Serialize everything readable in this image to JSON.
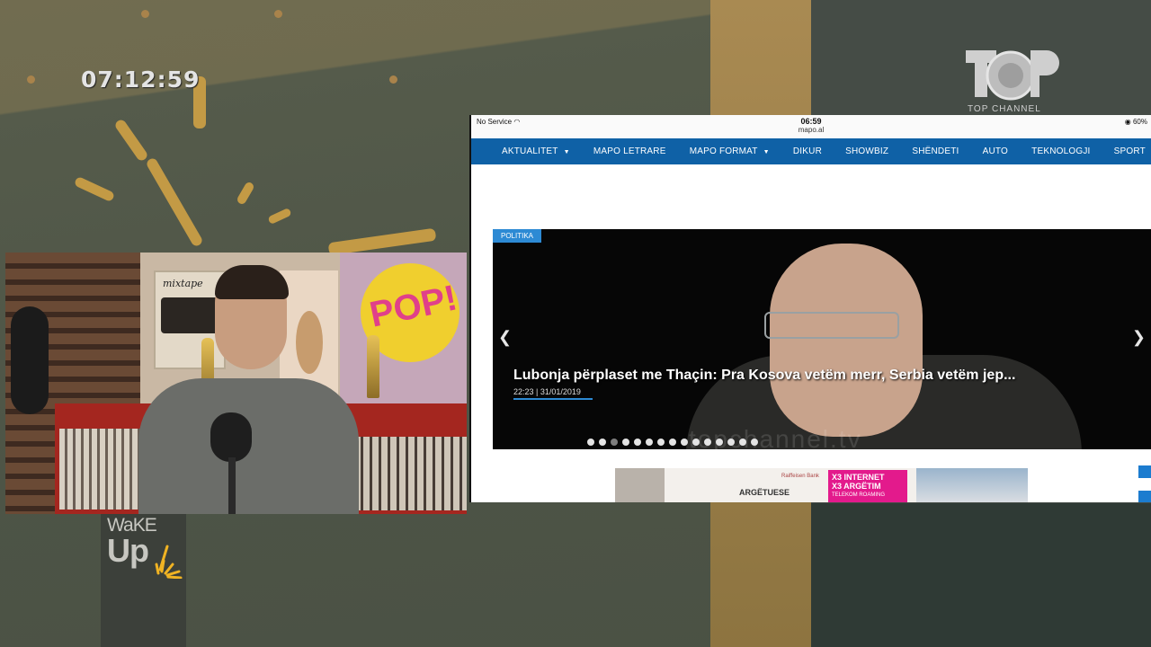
{
  "overlay": {
    "clock": "07:12:59",
    "channel_logo": "TOP CHANNEL",
    "show_logo": {
      "line1": "WaKE",
      "line2": "Up"
    }
  },
  "tablet": {
    "status": {
      "carrier": "No Service",
      "time": "06:59",
      "url": "mapo.al",
      "battery": "60%"
    },
    "nav": [
      {
        "label": "AKTUALITET",
        "has_dropdown": true
      },
      {
        "label": "MAPO LETRARE",
        "has_dropdown": false
      },
      {
        "label": "MAPO FORMAT",
        "has_dropdown": true
      },
      {
        "label": "DIKUR",
        "has_dropdown": false
      },
      {
        "label": "SHOWBIZ",
        "has_dropdown": false
      },
      {
        "label": "SHËNDETI",
        "has_dropdown": false
      },
      {
        "label": "AUTO",
        "has_dropdown": false
      },
      {
        "label": "TEKNOLOGJI",
        "has_dropdown": false
      },
      {
        "label": "SPORT",
        "has_dropdown": false
      }
    ],
    "slider": {
      "category": "POLITIKA",
      "headline": "Lubonja përplaset me Thaçin: Pra Kosova vetëm merr, Serbia vetëm jep...",
      "timestamp": "22:23 | 31/01/2019",
      "watermark": "topchannel.tv",
      "dots_total": 15,
      "dots_active": 2
    },
    "ad": {
      "bank_name": "Raiffeisen Bank",
      "title": "ARGËTUESE",
      "promo_line1": "X3 INTERNET",
      "promo_line2": "X3 ARGËTIM",
      "promo_line3": "TELEKOM ROAMING"
    }
  },
  "colors": {
    "nav_bg": "#0f61a6",
    "category_badge": "#2d8ad4",
    "ad_pink": "#e31a8c"
  }
}
